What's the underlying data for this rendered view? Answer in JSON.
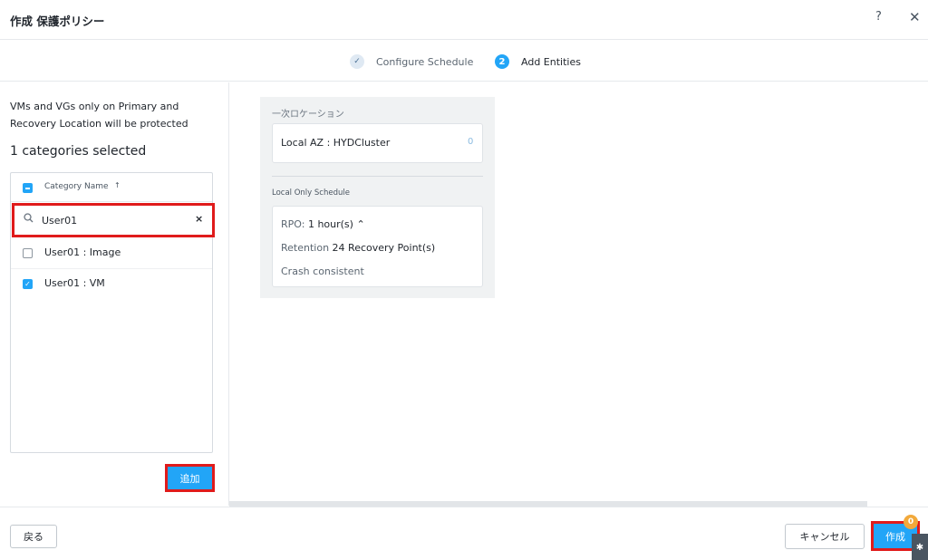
{
  "header": {
    "title": "作成 保護ポリシー",
    "help_icon": "?",
    "close_icon": "✕"
  },
  "stepper": {
    "steps": [
      {
        "label": "Configure Schedule",
        "marker": "✓",
        "state": "done"
      },
      {
        "label": "Add Entities",
        "marker": "2",
        "state": "active"
      }
    ]
  },
  "left_panel": {
    "note": "VMs and VGs only on Primary and Recovery Location will be protected",
    "selected_count": "1 categories selected",
    "column_header": "Category Name",
    "sort_indicator": "↑",
    "search": {
      "value": "User01",
      "clear": "×"
    },
    "categories": [
      {
        "label": "User01 : Image",
        "checked": false
      },
      {
        "label": "User01 : VM",
        "checked": true
      }
    ],
    "add_button": "追加"
  },
  "right_card": {
    "primary_location_label": "一次ロケーション",
    "location_name": "Local AZ : HYDCluster",
    "location_count": "0",
    "schedule_label": "Local Only Schedule",
    "rpo_label": "RPO:",
    "rpo_value": "1 hour(s)",
    "rpo_caret": "⌃",
    "retention_label": "Retention",
    "retention_value": "24 Recovery Point(s)",
    "consistency": "Crash consistent"
  },
  "footer": {
    "back_button": "戻る",
    "cancel_button": "キャンセル",
    "create_button": "作成",
    "notification_count": "0"
  },
  "colors": {
    "accent": "#22a5f7",
    "highlight": "#e01b1b",
    "notification": "#f2a93b"
  }
}
